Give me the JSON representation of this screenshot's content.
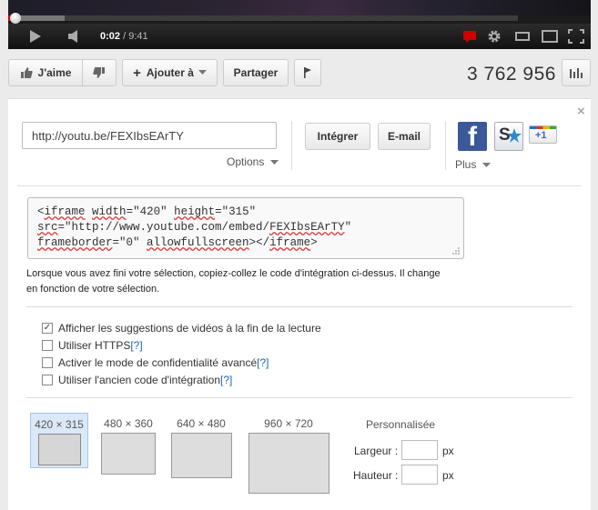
{
  "player": {
    "time_current": "0:02",
    "time_separator": " / ",
    "time_total": "9:41",
    "progress_buffered": 0.11,
    "progress_played": 0.005
  },
  "actions": {
    "like_label": "J'aime",
    "add_to_label": "Ajouter à",
    "share_label": "Partager",
    "view_count": "3 762 956"
  },
  "share": {
    "url": "http://youtu.be/FEXIbsEArTY",
    "options_label": "Options",
    "embed_button": "Intégrer",
    "email_button": "E-mail",
    "plus_label": "Plus",
    "gplus_label": "+1",
    "stumble_label": "S"
  },
  "embed": {
    "code_line1a": "<",
    "code_line1b": "iframe",
    "code_line1c": " ",
    "code_line1d": "width",
    "code_line1e": "=\"420\" ",
    "code_line1f": "height",
    "code_line1g": "=\"315\"",
    "code_line2a": "src",
    "code_line2b": "=\"http://www.youtube.com/embed/",
    "code_line2c": "FEXIbsEArTY",
    "code_line2d": "\"",
    "code_line3a": "frameborder",
    "code_line3b": "=\"0\" ",
    "code_line3c": "allowfullscreen",
    "code_line3d": "></",
    "code_line3e": "iframe",
    "code_line3f": ">",
    "help_text": "Lorsque vous avez fini votre sélection, copiez-collez le code d'intégration ci-dessus. Il change en fonction de votre sélection."
  },
  "options": [
    {
      "label": "Afficher les suggestions de vidéos à la fin de la lecture",
      "checked": true,
      "help": ""
    },
    {
      "label": "Utiliser HTTPS ",
      "checked": false,
      "help": "[?]"
    },
    {
      "label": "Activer le mode de confidentialité avancé ",
      "checked": false,
      "help": "[?]"
    },
    {
      "label": "Utiliser l'ancien code d'intégration ",
      "checked": false,
      "help": "[?]"
    }
  ],
  "sizes": [
    {
      "label": "420 × 315",
      "selected": true
    },
    {
      "label": "480 × 360",
      "selected": false
    },
    {
      "label": "640 × 480",
      "selected": false
    },
    {
      "label": "960 × 720",
      "selected": false
    }
  ],
  "custom": {
    "title": "Personnalisée",
    "width_label": "Largeur :",
    "height_label": "Hauteur :",
    "unit": "px",
    "width_value": "",
    "height_value": ""
  },
  "colors": {
    "progress_played": "#cc0000",
    "subtitle_icon": "#cc0000",
    "link_blue": "#2266bb",
    "facebook": "#3b5998"
  },
  "icons": {
    "play": "play-icon",
    "volume": "volume-icon",
    "captions": "captions-icon",
    "settings": "gear-icon",
    "close": "close-icon"
  }
}
